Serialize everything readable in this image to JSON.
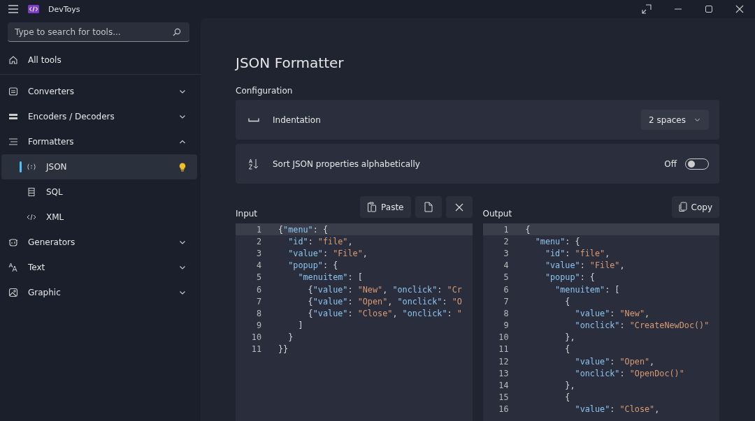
{
  "window": {
    "title": "DevToys"
  },
  "search": {
    "placeholder": "Type to search for tools..."
  },
  "sidebar": {
    "home": {
      "label": "All tools",
      "selected": false
    },
    "groups": [
      {
        "label": "Converters",
        "expanded": false
      },
      {
        "label": "Encoders / Decoders",
        "expanded": false
      },
      {
        "label": "Formatters",
        "expanded": true,
        "children": [
          {
            "label": "JSON",
            "selected": true,
            "recommended": true
          },
          {
            "label": "SQL",
            "selected": false,
            "recommended": false
          },
          {
            "label": "XML",
            "selected": false,
            "recommended": false
          }
        ]
      },
      {
        "label": "Generators",
        "expanded": false
      },
      {
        "label": "Text",
        "expanded": false
      },
      {
        "label": "Graphic",
        "expanded": false
      }
    ]
  },
  "page": {
    "title": "JSON Formatter",
    "section": "Configuration",
    "settings": [
      {
        "kind": "dropdown",
        "label": "Indentation",
        "value": "2 spaces"
      },
      {
        "kind": "toggle",
        "label": "Sort JSON properties alphabetically",
        "state_label": "Off",
        "on": false
      }
    ]
  },
  "input": {
    "label": "Input",
    "buttons": [
      {
        "kind": "paste",
        "label": "Paste"
      },
      {
        "kind": "file"
      },
      {
        "kind": "clear"
      }
    ],
    "lines": [
      {
        "number": "1",
        "tokens": [
          {
            "kind": "punct",
            "text": "{"
          },
          {
            "kind": "key",
            "text": "\"menu\""
          },
          {
            "kind": "punct",
            "text": ": {"
          }
        ]
      },
      {
        "number": "2",
        "tokens": [
          {
            "kind": "key",
            "text": "  \"id\""
          },
          {
            "kind": "punct",
            "text": ": "
          },
          {
            "kind": "str",
            "text": "\"file\""
          },
          {
            "kind": "punct",
            "text": ","
          }
        ]
      },
      {
        "number": "3",
        "tokens": [
          {
            "kind": "key",
            "text": "  \"value\""
          },
          {
            "kind": "punct",
            "text": ": "
          },
          {
            "kind": "str",
            "text": "\"File\""
          },
          {
            "kind": "punct",
            "text": ","
          }
        ]
      },
      {
        "number": "4",
        "tokens": [
          {
            "kind": "key",
            "text": "  \"popup\""
          },
          {
            "kind": "punct",
            "text": ": {"
          }
        ]
      },
      {
        "number": "5",
        "tokens": [
          {
            "kind": "key",
            "text": "    \"menuitem\""
          },
          {
            "kind": "punct",
            "text": ": ["
          }
        ]
      },
      {
        "number": "6",
        "tokens": [
          {
            "kind": "punct",
            "text": "      {"
          },
          {
            "kind": "key",
            "text": "\"value\""
          },
          {
            "kind": "punct",
            "text": ": "
          },
          {
            "kind": "str",
            "text": "\"New\""
          },
          {
            "kind": "punct",
            "text": ", "
          },
          {
            "kind": "key",
            "text": "\"onclick\""
          },
          {
            "kind": "punct",
            "text": ": "
          },
          {
            "kind": "str",
            "text": "\"Cr"
          }
        ]
      },
      {
        "number": "7",
        "tokens": [
          {
            "kind": "punct",
            "text": "      {"
          },
          {
            "kind": "key",
            "text": "\"value\""
          },
          {
            "kind": "punct",
            "text": ": "
          },
          {
            "kind": "str",
            "text": "\"Open\""
          },
          {
            "kind": "punct",
            "text": ", "
          },
          {
            "kind": "key",
            "text": "\"onclick\""
          },
          {
            "kind": "punct",
            "text": ": "
          },
          {
            "kind": "str",
            "text": "\"O"
          }
        ]
      },
      {
        "number": "8",
        "tokens": [
          {
            "kind": "punct",
            "text": "      {"
          },
          {
            "kind": "key",
            "text": "\"value\""
          },
          {
            "kind": "punct",
            "text": ": "
          },
          {
            "kind": "str",
            "text": "\"Close\""
          },
          {
            "kind": "punct",
            "text": ", "
          },
          {
            "kind": "key",
            "text": "\"onclick\""
          },
          {
            "kind": "punct",
            "text": ": "
          },
          {
            "kind": "str",
            "text": "\""
          }
        ]
      },
      {
        "number": "9",
        "tokens": [
          {
            "kind": "punct",
            "text": "    ]"
          }
        ]
      },
      {
        "number": "10",
        "tokens": [
          {
            "kind": "punct",
            "text": "  }"
          }
        ]
      },
      {
        "number": "11",
        "tokens": [
          {
            "kind": "punct",
            "text": "}}"
          }
        ]
      }
    ]
  },
  "output": {
    "label": "Output",
    "buttons": [
      {
        "kind": "copy",
        "label": "Copy"
      }
    ],
    "lines": [
      {
        "number": "1",
        "tokens": [
          {
            "kind": "punct",
            "text": "{"
          }
        ]
      },
      {
        "number": "2",
        "tokens": [
          {
            "kind": "key",
            "text": "  \"menu\""
          },
          {
            "kind": "punct",
            "text": ": {"
          }
        ]
      },
      {
        "number": "3",
        "tokens": [
          {
            "kind": "key",
            "text": "    \"id\""
          },
          {
            "kind": "punct",
            "text": ": "
          },
          {
            "kind": "str",
            "text": "\"file\""
          },
          {
            "kind": "punct",
            "text": ","
          }
        ]
      },
      {
        "number": "4",
        "tokens": [
          {
            "kind": "key",
            "text": "    \"value\""
          },
          {
            "kind": "punct",
            "text": ": "
          },
          {
            "kind": "str",
            "text": "\"File\""
          },
          {
            "kind": "punct",
            "text": ","
          }
        ]
      },
      {
        "number": "5",
        "tokens": [
          {
            "kind": "key",
            "text": "    \"popup\""
          },
          {
            "kind": "punct",
            "text": ": {"
          }
        ]
      },
      {
        "number": "6",
        "tokens": [
          {
            "kind": "key",
            "text": "      \"menuitem\""
          },
          {
            "kind": "punct",
            "text": ": ["
          }
        ]
      },
      {
        "number": "7",
        "tokens": [
          {
            "kind": "punct",
            "text": "        {"
          }
        ]
      },
      {
        "number": "8",
        "tokens": [
          {
            "kind": "key",
            "text": "          \"value\""
          },
          {
            "kind": "punct",
            "text": ": "
          },
          {
            "kind": "str",
            "text": "\"New\""
          },
          {
            "kind": "punct",
            "text": ","
          }
        ]
      },
      {
        "number": "9",
        "tokens": [
          {
            "kind": "key",
            "text": "          \"onclick\""
          },
          {
            "kind": "punct",
            "text": ": "
          },
          {
            "kind": "str",
            "text": "\"CreateNewDoc()\""
          }
        ]
      },
      {
        "number": "10",
        "tokens": [
          {
            "kind": "punct",
            "text": "        },"
          }
        ]
      },
      {
        "number": "11",
        "tokens": [
          {
            "kind": "punct",
            "text": "        {"
          }
        ]
      },
      {
        "number": "12",
        "tokens": [
          {
            "kind": "key",
            "text": "          \"value\""
          },
          {
            "kind": "punct",
            "text": ": "
          },
          {
            "kind": "str",
            "text": "\"Open\""
          },
          {
            "kind": "punct",
            "text": ","
          }
        ]
      },
      {
        "number": "13",
        "tokens": [
          {
            "kind": "key",
            "text": "          \"onclick\""
          },
          {
            "kind": "punct",
            "text": ": "
          },
          {
            "kind": "str",
            "text": "\"OpenDoc()\""
          }
        ]
      },
      {
        "number": "14",
        "tokens": [
          {
            "kind": "punct",
            "text": "        },"
          }
        ]
      },
      {
        "number": "15",
        "tokens": [
          {
            "kind": "punct",
            "text": "        {"
          }
        ]
      },
      {
        "number": "16",
        "tokens": [
          {
            "kind": "key",
            "text": "          \"value\""
          },
          {
            "kind": "punct",
            "text": ": "
          },
          {
            "kind": "str",
            "text": "\"Close\""
          },
          {
            "kind": "punct",
            "text": ","
          }
        ]
      }
    ]
  }
}
